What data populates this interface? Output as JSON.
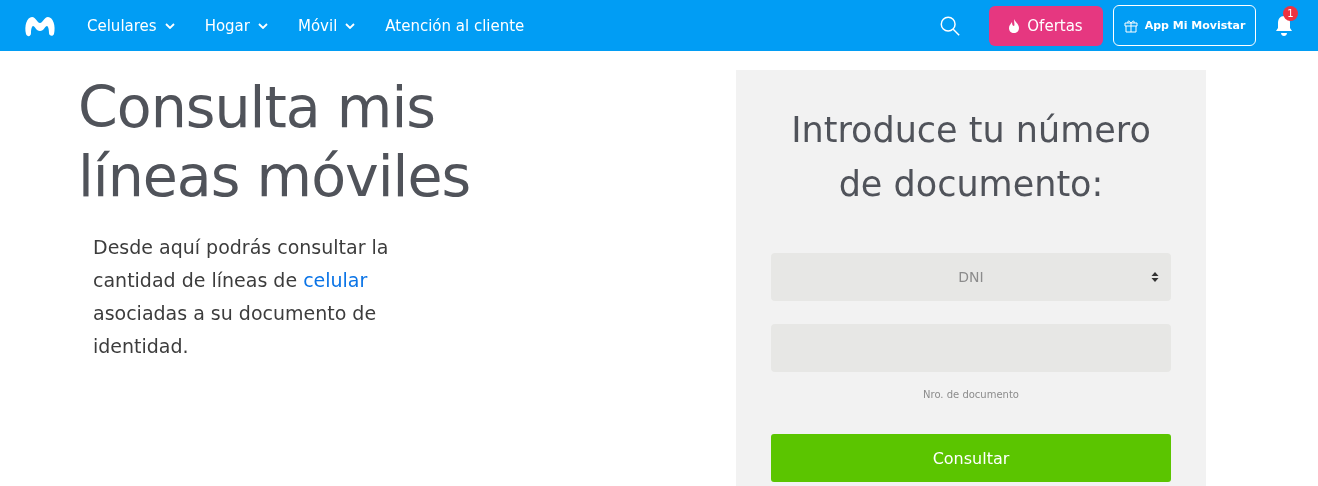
{
  "header": {
    "nav": [
      {
        "label": "Celulares",
        "kind": "dropdown"
      },
      {
        "label": "Hogar",
        "kind": "dropdown"
      },
      {
        "label": "Móvil",
        "kind": "dropdown"
      },
      {
        "label": "Atención al cliente",
        "kind": "link"
      }
    ],
    "offers_button": "Ofertas",
    "app_button": "App Mi Movistar",
    "notification_count": "1"
  },
  "title": "Consulta mis líneas móviles",
  "intro": {
    "before": "Desde aquí podrás consultar la cantidad de líneas de ",
    "link": "celular",
    "after": " asociadas a su documento de identidad."
  },
  "form": {
    "heading": "Introduce tu número de documento:",
    "document_type": "DNI",
    "number_field": {
      "helper": "Nro. de documento"
    },
    "submit": "Consultar"
  }
}
